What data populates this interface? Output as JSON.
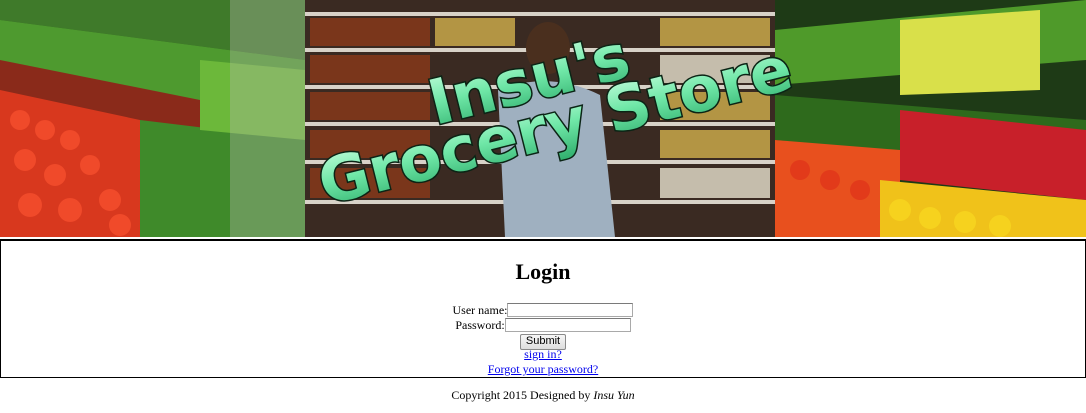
{
  "banner": {
    "line1": "Insu's",
    "line2": "Grocery Store"
  },
  "login": {
    "title": "Login",
    "username_label": "User name:",
    "username_value": "",
    "password_label": "Password:",
    "password_value": "",
    "submit_label": "Submit",
    "signin_link": "sign in?",
    "forgot_link": "Forgot your password?"
  },
  "footer": {
    "text": "Copyright 2015 Designed by ",
    "author": "Insu Yun"
  },
  "colors": {
    "banner_text_fill": "#7ff0b0",
    "banner_text_stroke": "#0a2a18",
    "link": "#0000ee"
  }
}
